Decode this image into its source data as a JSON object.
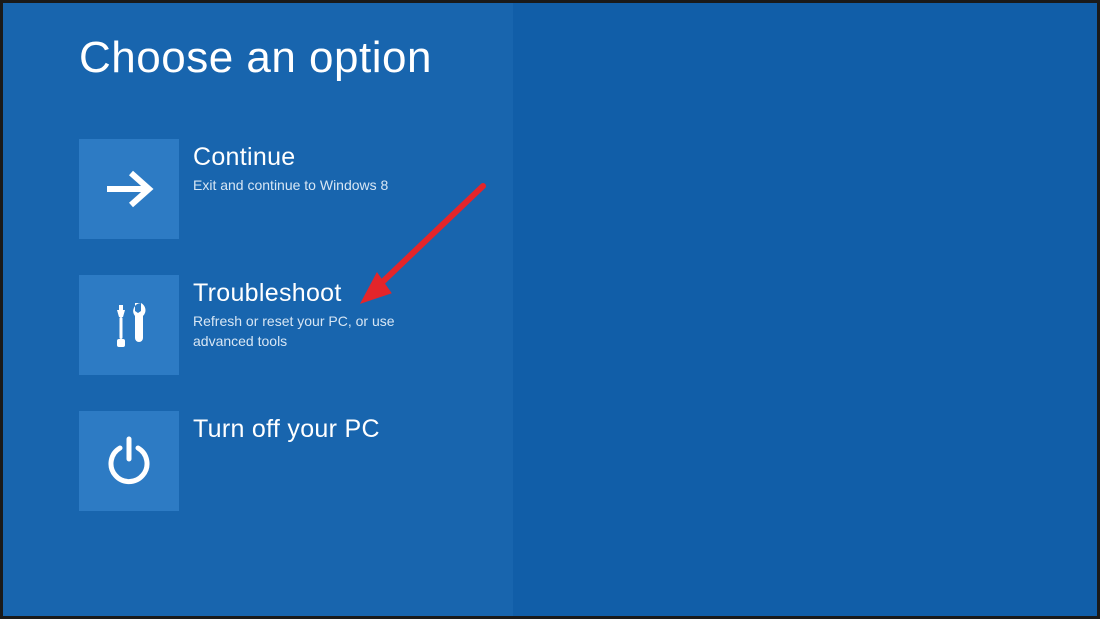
{
  "page": {
    "title": "Choose an option"
  },
  "options": {
    "continue": {
      "title": "Continue",
      "desc": "Exit and continue to Windows 8"
    },
    "troubleshoot": {
      "title": "Troubleshoot",
      "desc": "Refresh or reset your PC, or use advanced tools"
    },
    "turnoff": {
      "title": "Turn off your PC",
      "desc": ""
    }
  },
  "colors": {
    "bg": "#115ea8",
    "panel": "#1865ae",
    "tile": "#2d7bc4",
    "arrow": "#e4252a"
  }
}
